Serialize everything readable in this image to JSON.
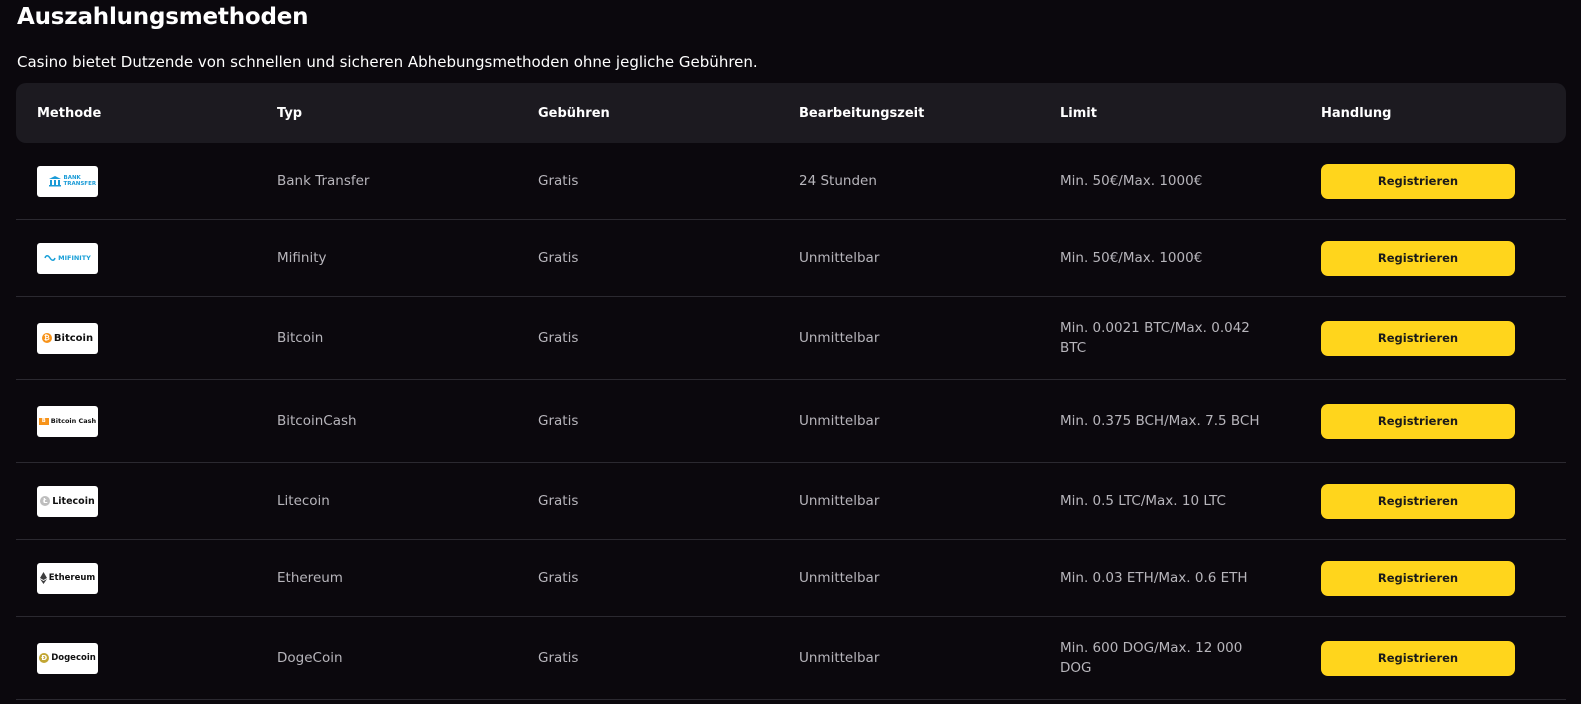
{
  "page": {
    "title": "Auszahlungsmethoden",
    "subtitle": "Casino bietet Dutzende von schnellen und sicheren Abhebungsmethoden ohne jegliche Gebühren."
  },
  "table": {
    "headers": [
      "Methode",
      "Typ",
      "Gebühren",
      "Bearbeitungszeit",
      "Limit",
      "Handlung"
    ],
    "rows": [
      {
        "logo_text": "BANK TRANSFER",
        "logo_icon": "bank-icon",
        "type": "Bank Transfer",
        "fee": "Gratis",
        "time": "24 Stunden",
        "limit": "Min. 50€/Max. 1000€",
        "action": "Registrieren"
      },
      {
        "logo_text": "MIFINITY",
        "logo_icon": "mifinity-icon",
        "type": "Mifinity",
        "fee": "Gratis",
        "time": "Unmittelbar",
        "limit": "Min. 50€/Max. 1000€",
        "action": "Registrieren"
      },
      {
        "logo_text": "Bitcoin",
        "logo_icon": "bitcoin-icon",
        "type": "Bitcoin",
        "fee": "Gratis",
        "time": "Unmittelbar",
        "limit": "Min. 0.0021 BTC/Max. 0.042 BTC",
        "action": "Registrieren"
      },
      {
        "logo_text": "Bitcoin Cash",
        "logo_icon": "bitcoin-cash-icon",
        "type": "BitcoinCash",
        "fee": "Gratis",
        "time": "Unmittelbar",
        "limit": "Min. 0.375 BCH/Max. 7.5 BCH",
        "action": "Registrieren"
      },
      {
        "logo_text": "Litecoin",
        "logo_icon": "litecoin-icon",
        "type": "Litecoin",
        "fee": "Gratis",
        "time": "Unmittelbar",
        "limit": "Min. 0.5 LTC/Max. 10 LTC",
        "action": "Registrieren"
      },
      {
        "logo_text": "Ethereum",
        "logo_icon": "ethereum-icon",
        "type": "Ethereum",
        "fee": "Gratis",
        "time": "Unmittelbar",
        "limit": "Min. 0.03 ETH/Max. 0.6 ETH",
        "action": "Registrieren"
      },
      {
        "logo_text": "Dogecoin",
        "logo_icon": "dogecoin-icon",
        "type": "DogeCoin",
        "fee": "Gratis",
        "time": "Unmittelbar",
        "limit": "Min. 600 DOG/Max. 12 000 DOG",
        "action": "Registrieren"
      }
    ]
  },
  "colors": {
    "background": "#0b080d",
    "header_bg": "#1c1a20",
    "button": "#ffd51c",
    "bitcoin": "#f7931a",
    "bitcoin_cash": "#f7931a",
    "litecoin": "#bebebe",
    "ethereum": "#3c3c3d",
    "dogecoin": "#c2a633",
    "bank": "#1a9bd7",
    "mifinity": "#1aa0d8"
  }
}
